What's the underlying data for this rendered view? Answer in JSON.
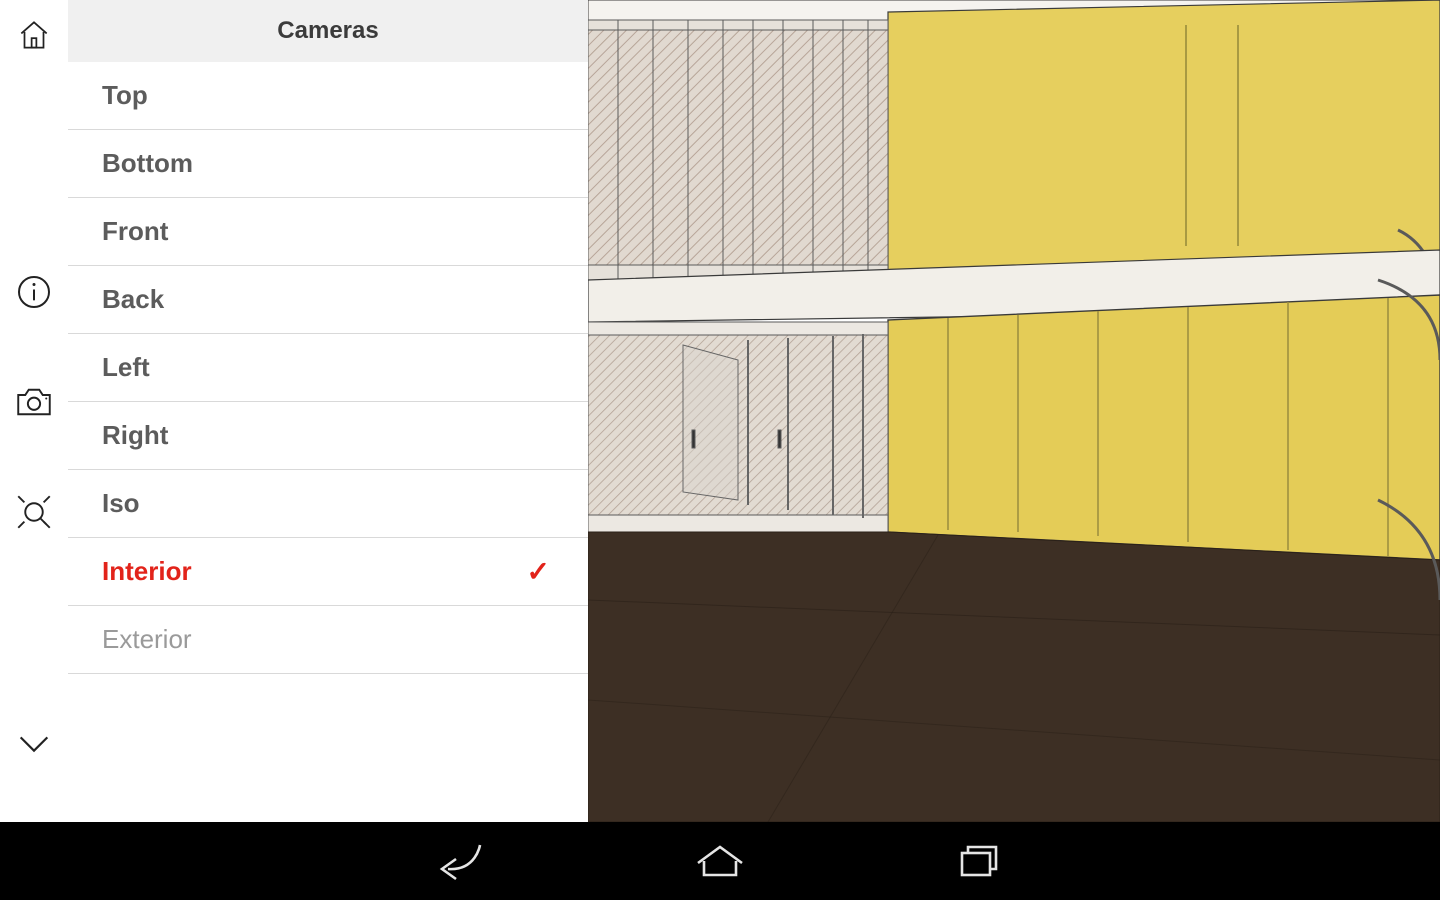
{
  "panel": {
    "title": "Cameras",
    "items": [
      {
        "label": "Top",
        "selected": false,
        "disabled": false
      },
      {
        "label": "Bottom",
        "selected": false,
        "disabled": false
      },
      {
        "label": "Front",
        "selected": false,
        "disabled": false
      },
      {
        "label": "Back",
        "selected": false,
        "disabled": false
      },
      {
        "label": "Left",
        "selected": false,
        "disabled": false
      },
      {
        "label": "Right",
        "selected": false,
        "disabled": false
      },
      {
        "label": "Iso",
        "selected": false,
        "disabled": false
      },
      {
        "label": "Interior",
        "selected": true,
        "disabled": false
      },
      {
        "label": "Exterior",
        "selected": false,
        "disabled": true
      }
    ]
  },
  "toolbar": {
    "home": "home-icon",
    "info": "info-icon",
    "camera": "camera-icon",
    "fit": "fit-view-icon",
    "chevron": "chevron-down-icon"
  },
  "navbar": {
    "back": "back-icon",
    "home": "home-icon",
    "recents": "recents-icon"
  },
  "scene": {
    "floor_color": "#3d2f24",
    "wall_color": "#e6cf5e",
    "mullion_color": "#7a7a7a",
    "glass_color": "#d7d2cc"
  }
}
